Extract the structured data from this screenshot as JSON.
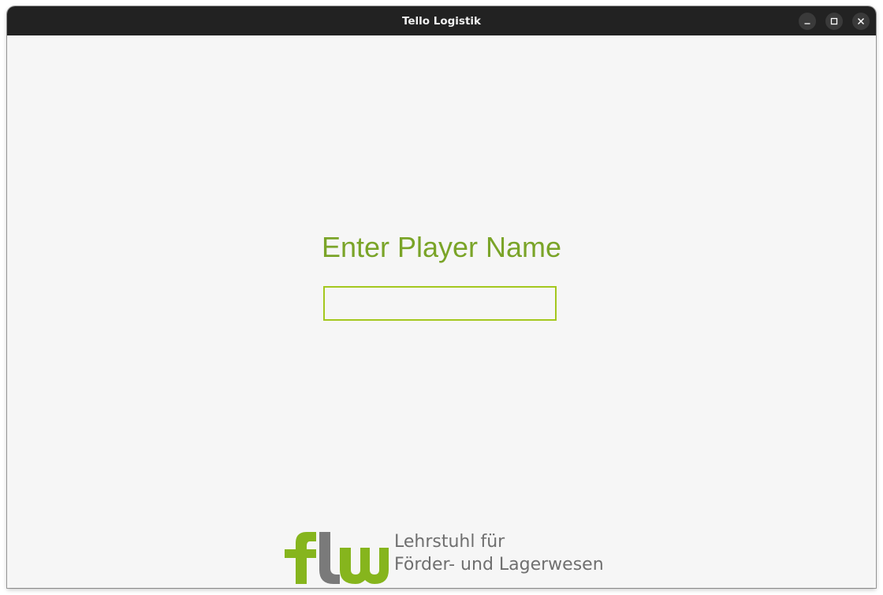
{
  "window": {
    "title": "Tello Logistik",
    "controls": {
      "minimize": "minimize-icon",
      "maximize": "maximize-icon",
      "close": "close-icon"
    }
  },
  "main": {
    "heading": "Enter Player Name",
    "player_name_input": {
      "value": "",
      "placeholder": ""
    }
  },
  "footer": {
    "logo_mark": "flw",
    "logo_line1": "Lehrstuhl für",
    "logo_line2": "Förder- und Lagerwesen"
  },
  "colors": {
    "titlebar": "#222222",
    "background": "#f6f6f6",
    "accent_green": "#7aa428",
    "input_border": "#a4c81e",
    "logo_gray": "#6f6f6f"
  }
}
